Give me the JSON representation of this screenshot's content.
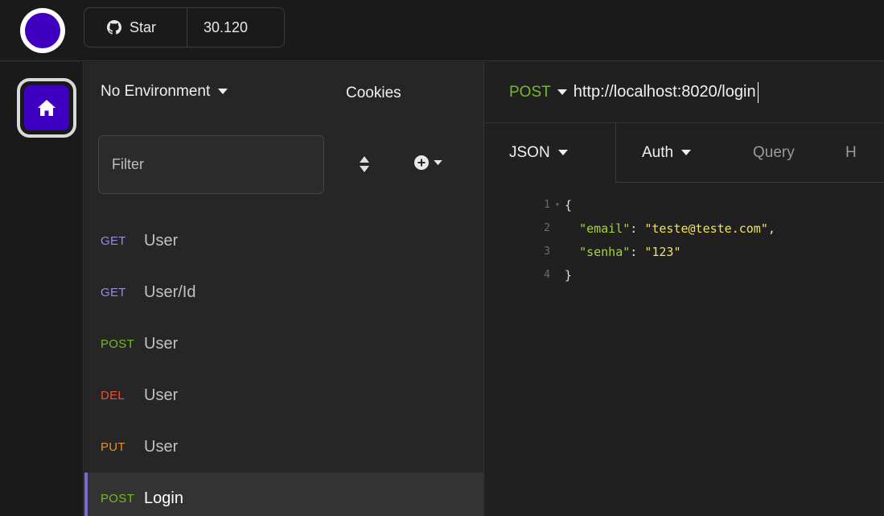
{
  "topbar": {
    "star_label": "Star",
    "star_count": "30.120"
  },
  "sidebar": {
    "environment": "No Environment",
    "cookies": "Cookies",
    "filter_placeholder": "Filter",
    "requests": [
      {
        "method": "GET",
        "name": "User",
        "color": "#9b8be0"
      },
      {
        "method": "GET",
        "name": "User/Id",
        "color": "#9b8be0"
      },
      {
        "method": "POST",
        "name": "User",
        "color": "#75ba24"
      },
      {
        "method": "DEL",
        "name": "User",
        "color": "#e5533d"
      },
      {
        "method": "PUT",
        "name": "User",
        "color": "#e88d2f"
      },
      {
        "method": "POST",
        "name": "Login",
        "color": "#75ba24"
      }
    ]
  },
  "request": {
    "method": "POST",
    "url": "http://localhost:8020/login"
  },
  "tabs": {
    "json": "JSON",
    "auth": "Auth",
    "query": "Query",
    "headers_partial": "H"
  },
  "editor": {
    "line_numbers": [
      "1",
      "2",
      "3",
      "4"
    ],
    "open_brace": "{",
    "key1": "\"email\"",
    "val1": "\"teste@teste.com\"",
    "key2": "\"senha\"",
    "val2": "\"123\"",
    "close_brace": "}"
  }
}
